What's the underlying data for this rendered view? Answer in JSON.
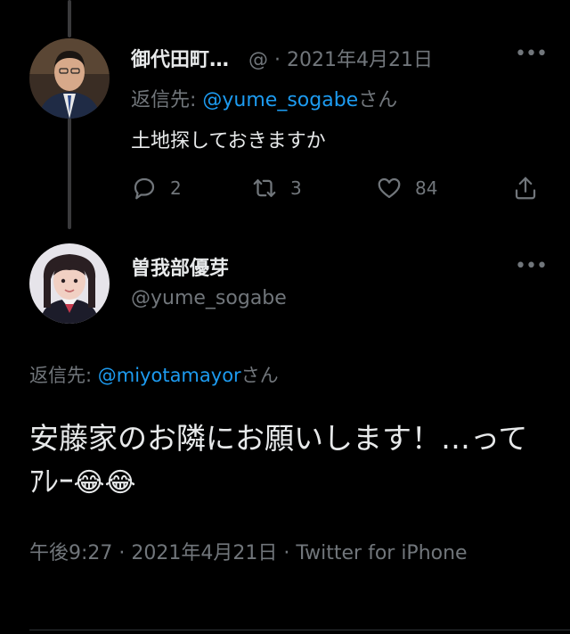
{
  "tweet1": {
    "display_name": "御代田町…",
    "handle_date": "@ · 2021年4月21日",
    "reply_prefix": "返信先: ",
    "reply_handle": "@yume_sogabe",
    "reply_suffix": "さん",
    "text": "土地探しておきますか",
    "reply_count": "2",
    "retweet_count": "3",
    "like_count": "84"
  },
  "tweet2": {
    "display_name": "曽我部優芽",
    "handle": "@yume_sogabe",
    "reply_prefix": "返信先: ",
    "reply_handle": "@miyotamayor",
    "reply_suffix": "さん",
    "text": "安藤家のお隣にお願いします！…ってｱﾚｰ",
    "emojis": "😂😂",
    "meta": "午後9:27 · 2021年4月21日 · Twitter for iPhone"
  },
  "more_label": "•••",
  "colors": {
    "background": "#000000",
    "text": "#e7e9ea",
    "muted": "#71767b",
    "link": "#1d9bf0"
  },
  "icons": [
    "reply-icon",
    "retweet-icon",
    "like-icon",
    "share-icon",
    "more-icon"
  ]
}
